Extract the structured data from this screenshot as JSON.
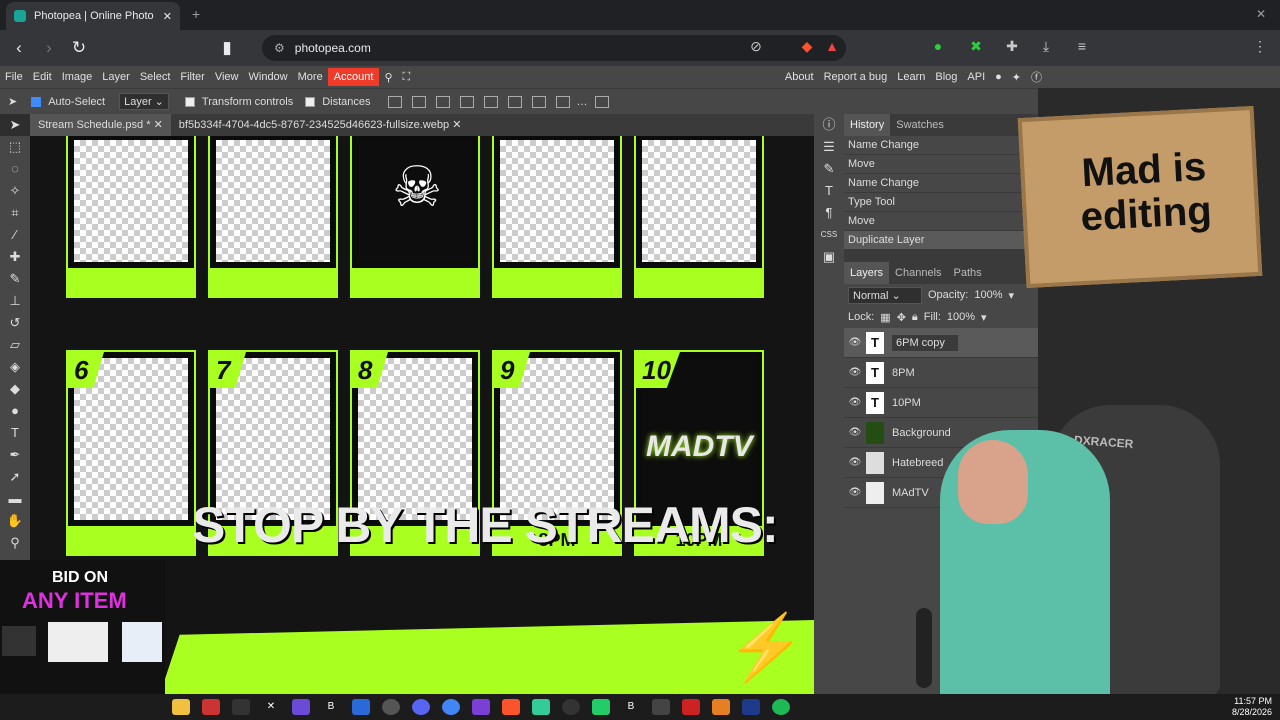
{
  "browser": {
    "tab_title": "Photopea | Online Photo Edit",
    "close": "✕",
    "new_tab": "+",
    "url": "photopea.com"
  },
  "menu": [
    "File",
    "Edit",
    "Image",
    "Layer",
    "Select",
    "Filter",
    "View",
    "Window",
    "More"
  ],
  "account_label": "Account",
  "right_menu": [
    "About",
    "Report a bug",
    "Learn",
    "Blog",
    "API"
  ],
  "options": {
    "auto_select": "Auto-Select",
    "layer_select": "Layer",
    "transform_controls": "Transform controls",
    "distances": "Distances"
  },
  "doc_tabs": [
    "Stream Schedule.psd *",
    "bf5b334f-4704-4dc5-8767-234525d46623-fullsize.webp"
  ],
  "schedule": {
    "numbers": [
      "6",
      "7",
      "8",
      "9",
      "10"
    ],
    "times": [
      "8PM",
      "10PM"
    ],
    "brand": "MADTV",
    "banner": "STOP BY THE STREAMS:"
  },
  "history": {
    "tabs": [
      "History",
      "Swatches"
    ],
    "items": [
      "Name Change",
      "Move",
      "Name Change",
      "Type Tool",
      "Move",
      "Duplicate Layer"
    ]
  },
  "layers": {
    "tabs": [
      "Layers",
      "Channels",
      "Paths"
    ],
    "blend": "Normal",
    "opacity_label": "Opacity:",
    "opacity": "100%",
    "lock_label": "Lock:",
    "fill_label": "Fill:",
    "fill": "100%",
    "items": [
      "6PM copy",
      "8PM",
      "10PM",
      "Background",
      "Hatebreed",
      "MAdTV"
    ]
  },
  "overlay": {
    "sign": "Mad is editing",
    "bid_line1": "BID ON",
    "bid_line2": "ANY ITEM",
    "chair_brand": "DXRACER"
  },
  "clock": {
    "time": "11:57 PM",
    "date": "8/28/2026"
  },
  "colors": {
    "accent": "#a9ff20",
    "account": "#ef3b2a"
  }
}
